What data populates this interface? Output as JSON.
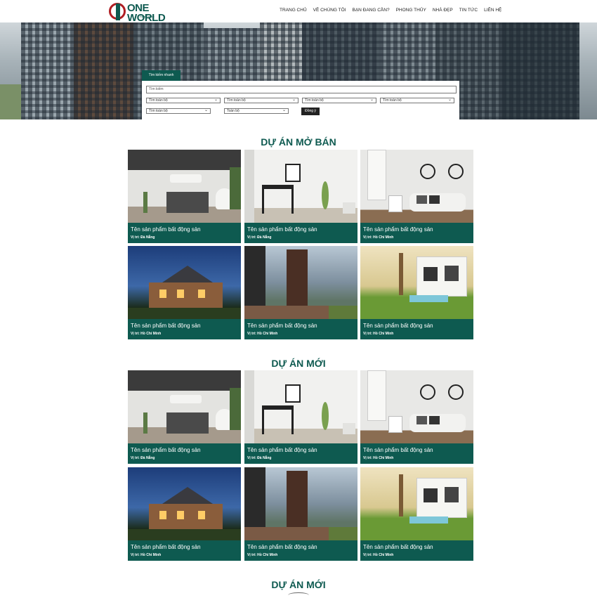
{
  "brand": {
    "logo_text": "ONE WORLD",
    "logo_sub": "Real Estate"
  },
  "nav": [
    "TRANG CHỦ",
    "VỀ CHÚNG TÔI",
    "BẠN ĐANG CẦN?",
    "PHONG THỦY",
    "NHÀ ĐẸP",
    "TIN TỨC",
    "LIÊN HỆ"
  ],
  "search": {
    "tab": "Tìm kiếm nhanh",
    "placeholder": "Tìm kiếm",
    "selects_row1": [
      "Tìm toàn bộ",
      "Tìm toàn bộ",
      "Tìm toàn bộ",
      "Tìm toàn bộ"
    ],
    "selects_row2": [
      "Tìm toàn bộ",
      "Toàn bộ"
    ],
    "submit": "Đồng ý"
  },
  "sections": [
    {
      "title": "DỰ ÁN MỞ BÁN",
      "cards": [
        {
          "name": "Tên sản phẩm bất động sản",
          "location": "Vị trí: Đà Nẵng",
          "scene": "bathroom"
        },
        {
          "name": "Tên sản phẩm bất động sản",
          "location": "Vị trí: Đà Nẵng",
          "scene": "workspace"
        },
        {
          "name": "Tên sản phẩm bất động sản",
          "location": "Vị trí: Hồ Chí Minh",
          "scene": "living-room"
        },
        {
          "name": "Tên sản phẩm bất động sản",
          "location": "Vị trí: Hồ Chí Minh",
          "scene": "house-night"
        },
        {
          "name": "Tên sản phẩm bất động sản",
          "location": "Vị trí: Hồ Chí Minh",
          "scene": "terrace"
        },
        {
          "name": "Tên sản phẩm bất động sản",
          "location": "Vị trí: Hồ Chí Minh",
          "scene": "villa-pool"
        }
      ]
    },
    {
      "title": "DỰ ÁN MỚI",
      "cards": [
        {
          "name": "Tên sản phẩm bất động sản",
          "location": "Vị trí: Đà Nẵng",
          "scene": "bathroom"
        },
        {
          "name": "Tên sản phẩm bất động sản",
          "location": "Vị trí: Đà Nẵng",
          "scene": "workspace"
        },
        {
          "name": "Tên sản phẩm bất động sản",
          "location": "Vị trí: Hồ Chí Minh",
          "scene": "living-room"
        },
        {
          "name": "Tên sản phẩm bất động sản",
          "location": "Vị trí: Hồ Chí Minh",
          "scene": "house-night"
        },
        {
          "name": "Tên sản phẩm bất động sản",
          "location": "Vị trí: Hồ Chí Minh",
          "scene": "terrace"
        },
        {
          "name": "Tên sản phẩm bất động sản",
          "location": "Vị trí: Hồ Chí Minh",
          "scene": "villa-pool"
        }
      ]
    }
  ],
  "footer_section": {
    "title": "DỰ ÁN MỚI"
  },
  "colors": {
    "brand_green": "#0e5a50",
    "brand_red": "#b01e23"
  }
}
